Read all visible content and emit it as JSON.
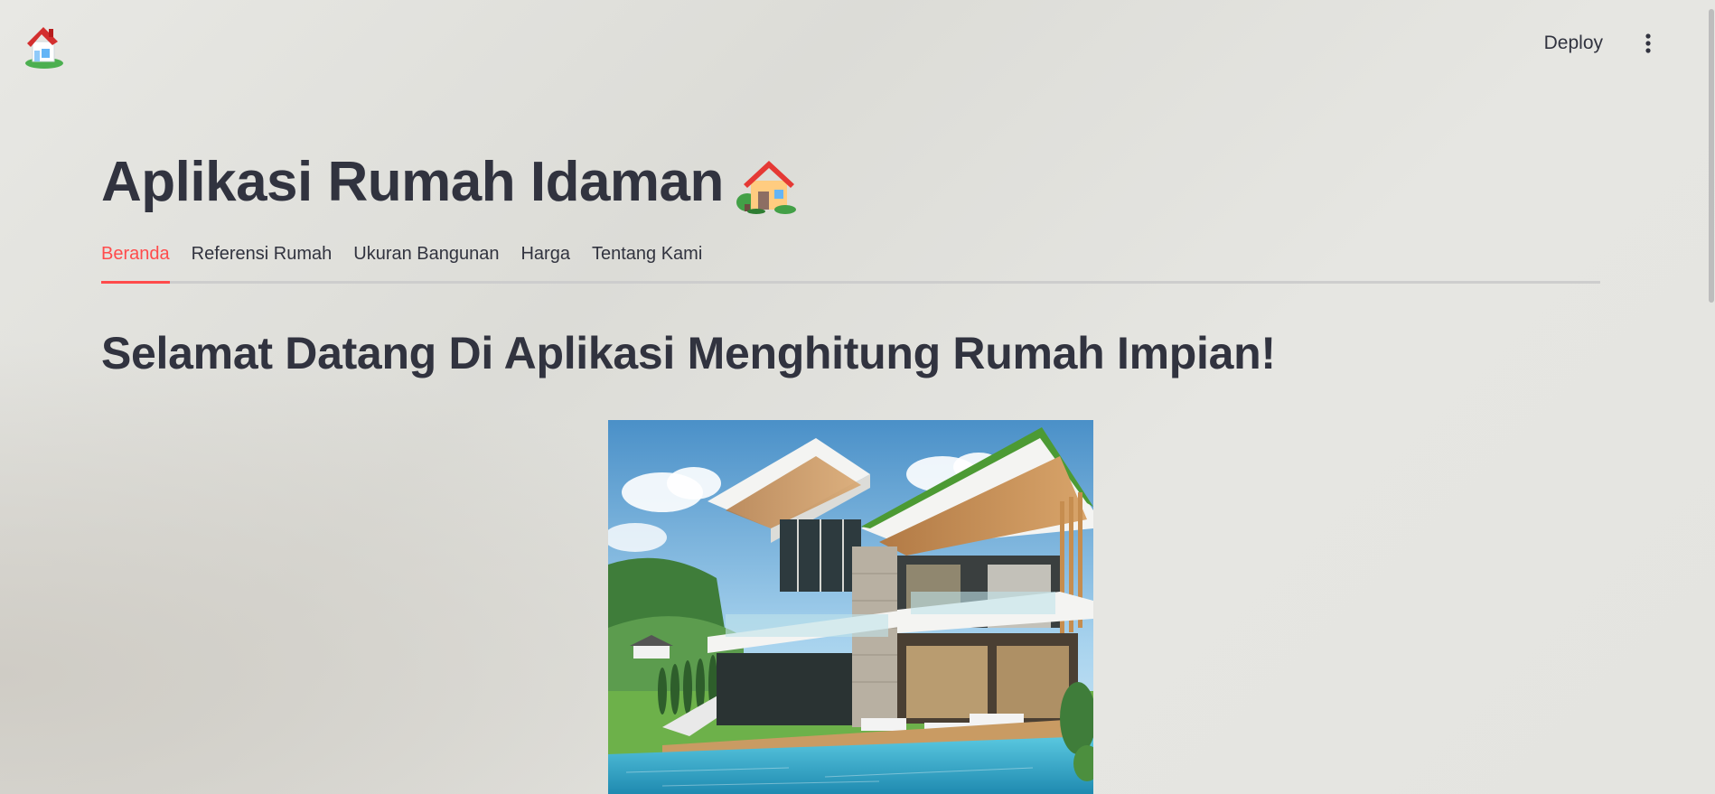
{
  "header": {
    "logo_icon": "house-logo-icon",
    "deploy_label": "Deploy",
    "menu_icon": "vertical-dots-icon"
  },
  "main": {
    "title": "Aplikasi Rumah Idaman",
    "title_icon": "house-with-garden-icon",
    "tabs": [
      {
        "label": "Beranda",
        "active": true
      },
      {
        "label": "Referensi Rumah",
        "active": false
      },
      {
        "label": "Ukuran Bangunan",
        "active": false
      },
      {
        "label": "Harga",
        "active": false
      },
      {
        "label": "Tentang Kami",
        "active": false
      }
    ],
    "welcome_heading": "Selamat Datang Di Aplikasi Menghitung Rumah Impian!",
    "hero_image": "modern-villa-with-pool-image"
  },
  "colors": {
    "accent": "#ff4b4b",
    "text": "#31333f",
    "tab_border": "#cdcdcd"
  }
}
